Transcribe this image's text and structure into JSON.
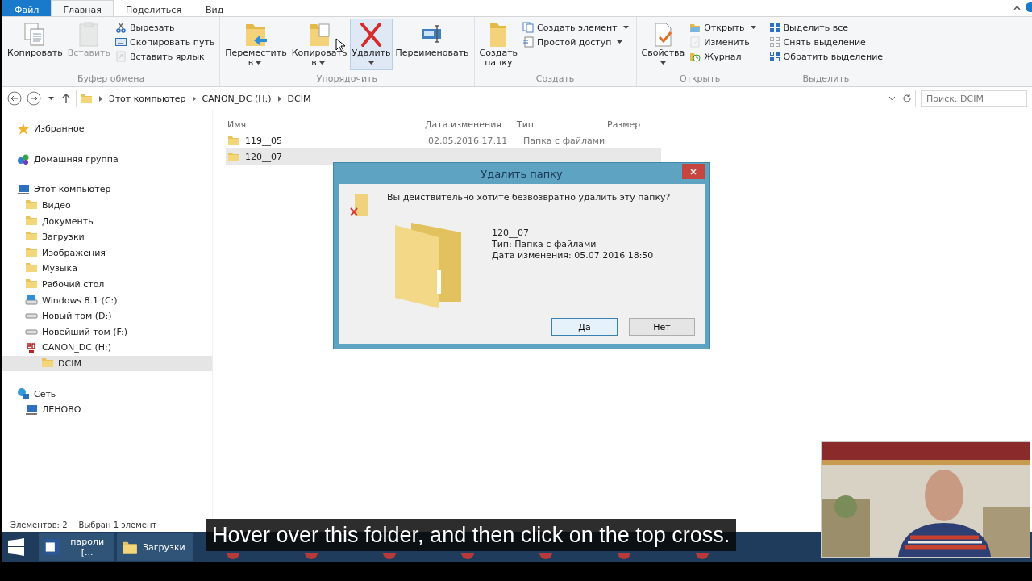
{
  "ribbon": {
    "tabs": [
      {
        "label": "Файл",
        "kind": "file",
        "selected": false
      },
      {
        "label": "Главная",
        "kind": "tab",
        "selected": true
      },
      {
        "label": "Поделиться",
        "kind": "tab",
        "selected": false
      },
      {
        "label": "Вид",
        "kind": "tab",
        "selected": false
      }
    ],
    "groups": [
      {
        "label": "Буфер обмена",
        "items": [
          {
            "kind": "large",
            "label": "Копировать",
            "disabled": false
          },
          {
            "kind": "large",
            "label": "Вставить",
            "disabled": true
          },
          {
            "kind": "small",
            "label": "Вырезать",
            "disabled": false
          },
          {
            "kind": "small",
            "label": "Скопировать путь",
            "disabled": false
          },
          {
            "kind": "small",
            "label": "Вставить ярлык",
            "disabled": true
          }
        ]
      },
      {
        "label": "Упорядочить",
        "items": [
          {
            "kind": "large",
            "label": "Переместить в",
            "dropdown": true
          },
          {
            "kind": "large",
            "label": "Копировать в",
            "dropdown": true
          },
          {
            "kind": "large",
            "label": "Удалить",
            "dropdown": true,
            "hovered": true
          },
          {
            "kind": "large",
            "label": "Переименовать"
          }
        ]
      },
      {
        "label": "Создать",
        "items": [
          {
            "kind": "large",
            "label": "Создать папку"
          },
          {
            "kind": "small",
            "label": "Создать элемент",
            "dropdown": true
          },
          {
            "kind": "small",
            "label": "Простой доступ",
            "dropdown": true
          }
        ]
      },
      {
        "label": "Открыть",
        "items": [
          {
            "kind": "large",
            "label": "Свойства",
            "dropdown": true
          },
          {
            "kind": "small",
            "label": "Открыть",
            "dropdown": true,
            "disabled": false
          },
          {
            "kind": "small",
            "label": "Изменить",
            "disabled": true
          },
          {
            "kind": "small",
            "label": "Журнал",
            "disabled": false
          }
        ]
      },
      {
        "label": "Выделить",
        "items": [
          {
            "kind": "small",
            "label": "Выделить все"
          },
          {
            "kind": "small",
            "label": "Снять выделение"
          },
          {
            "kind": "small",
            "label": "Обратить выделение"
          }
        ]
      }
    ]
  },
  "address": {
    "path": [
      "Этот компьютер",
      "CANON_DC (H:)",
      "DCIM"
    ],
    "search": {
      "placeholder": "Поиск: DCIM"
    }
  },
  "sidebar": {
    "items": [
      {
        "label": "Избранное",
        "selected": false
      },
      {
        "label": "Домашняя группа",
        "selected": false
      },
      {
        "label": "Этот компьютер",
        "selected": false,
        "children": [
          {
            "label": "Видео",
            "selected": false
          },
          {
            "label": "Документы",
            "selected": false
          },
          {
            "label": "Загрузки",
            "selected": false
          },
          {
            "label": "Изображения",
            "selected": false
          },
          {
            "label": "Музыка",
            "selected": false
          },
          {
            "label": "Рабочий стол",
            "selected": false
          },
          {
            "label": "Windows 8.1 (C:)",
            "selected": false
          },
          {
            "label": "Новый том (D:)",
            "selected": false
          },
          {
            "label": "Новейший том (F:)",
            "selected": false
          },
          {
            "label": "CANON_DC (H:)",
            "selected": false,
            "children": [
              {
                "label": "DCIM",
                "selected": true
              }
            ]
          }
        ]
      },
      {
        "label": "Сеть",
        "selected": false,
        "children": [
          {
            "label": "ЛЕНОВО",
            "selected": false
          }
        ]
      }
    ]
  },
  "table": {
    "columns": [
      "Имя",
      "Дата изменения",
      "Тип",
      "Размер"
    ],
    "rows": [
      {
        "name": "119__05",
        "date": "02.05.2016 17:11",
        "type": "Папка с файлами",
        "selected": false
      },
      {
        "name": "120__07",
        "selected": true
      }
    ]
  },
  "status_bar": {
    "count": "Элементов: 2",
    "selection": "Выбран 1 элемент"
  },
  "dialog": {
    "title": "Удалить папку",
    "question": "Вы действительно хотите безвозвратно удалить эту папку?",
    "name": "120__07",
    "type": "Тип: Папка с файлами",
    "date": "Дата изменения: 05.07.2016 18:50",
    "buttons": [
      {
        "label": "Да",
        "selected": true
      },
      {
        "label": "Нет",
        "selected": false
      }
    ]
  },
  "taskbar": {
    "items": [
      {
        "label": "пароли [...",
        "kind": "word"
      },
      {
        "label": "Загрузки",
        "kind": "folder"
      },
      {
        "kind": "icon"
      },
      {
        "kind": "icon"
      },
      {
        "kind": "icon"
      },
      {
        "kind": "icon"
      },
      {
        "kind": "icon"
      },
      {
        "kind": "icon"
      },
      {
        "kind": "icon"
      }
    ]
  },
  "subtitle": "Hover over this folder, and then click on the top cross."
}
